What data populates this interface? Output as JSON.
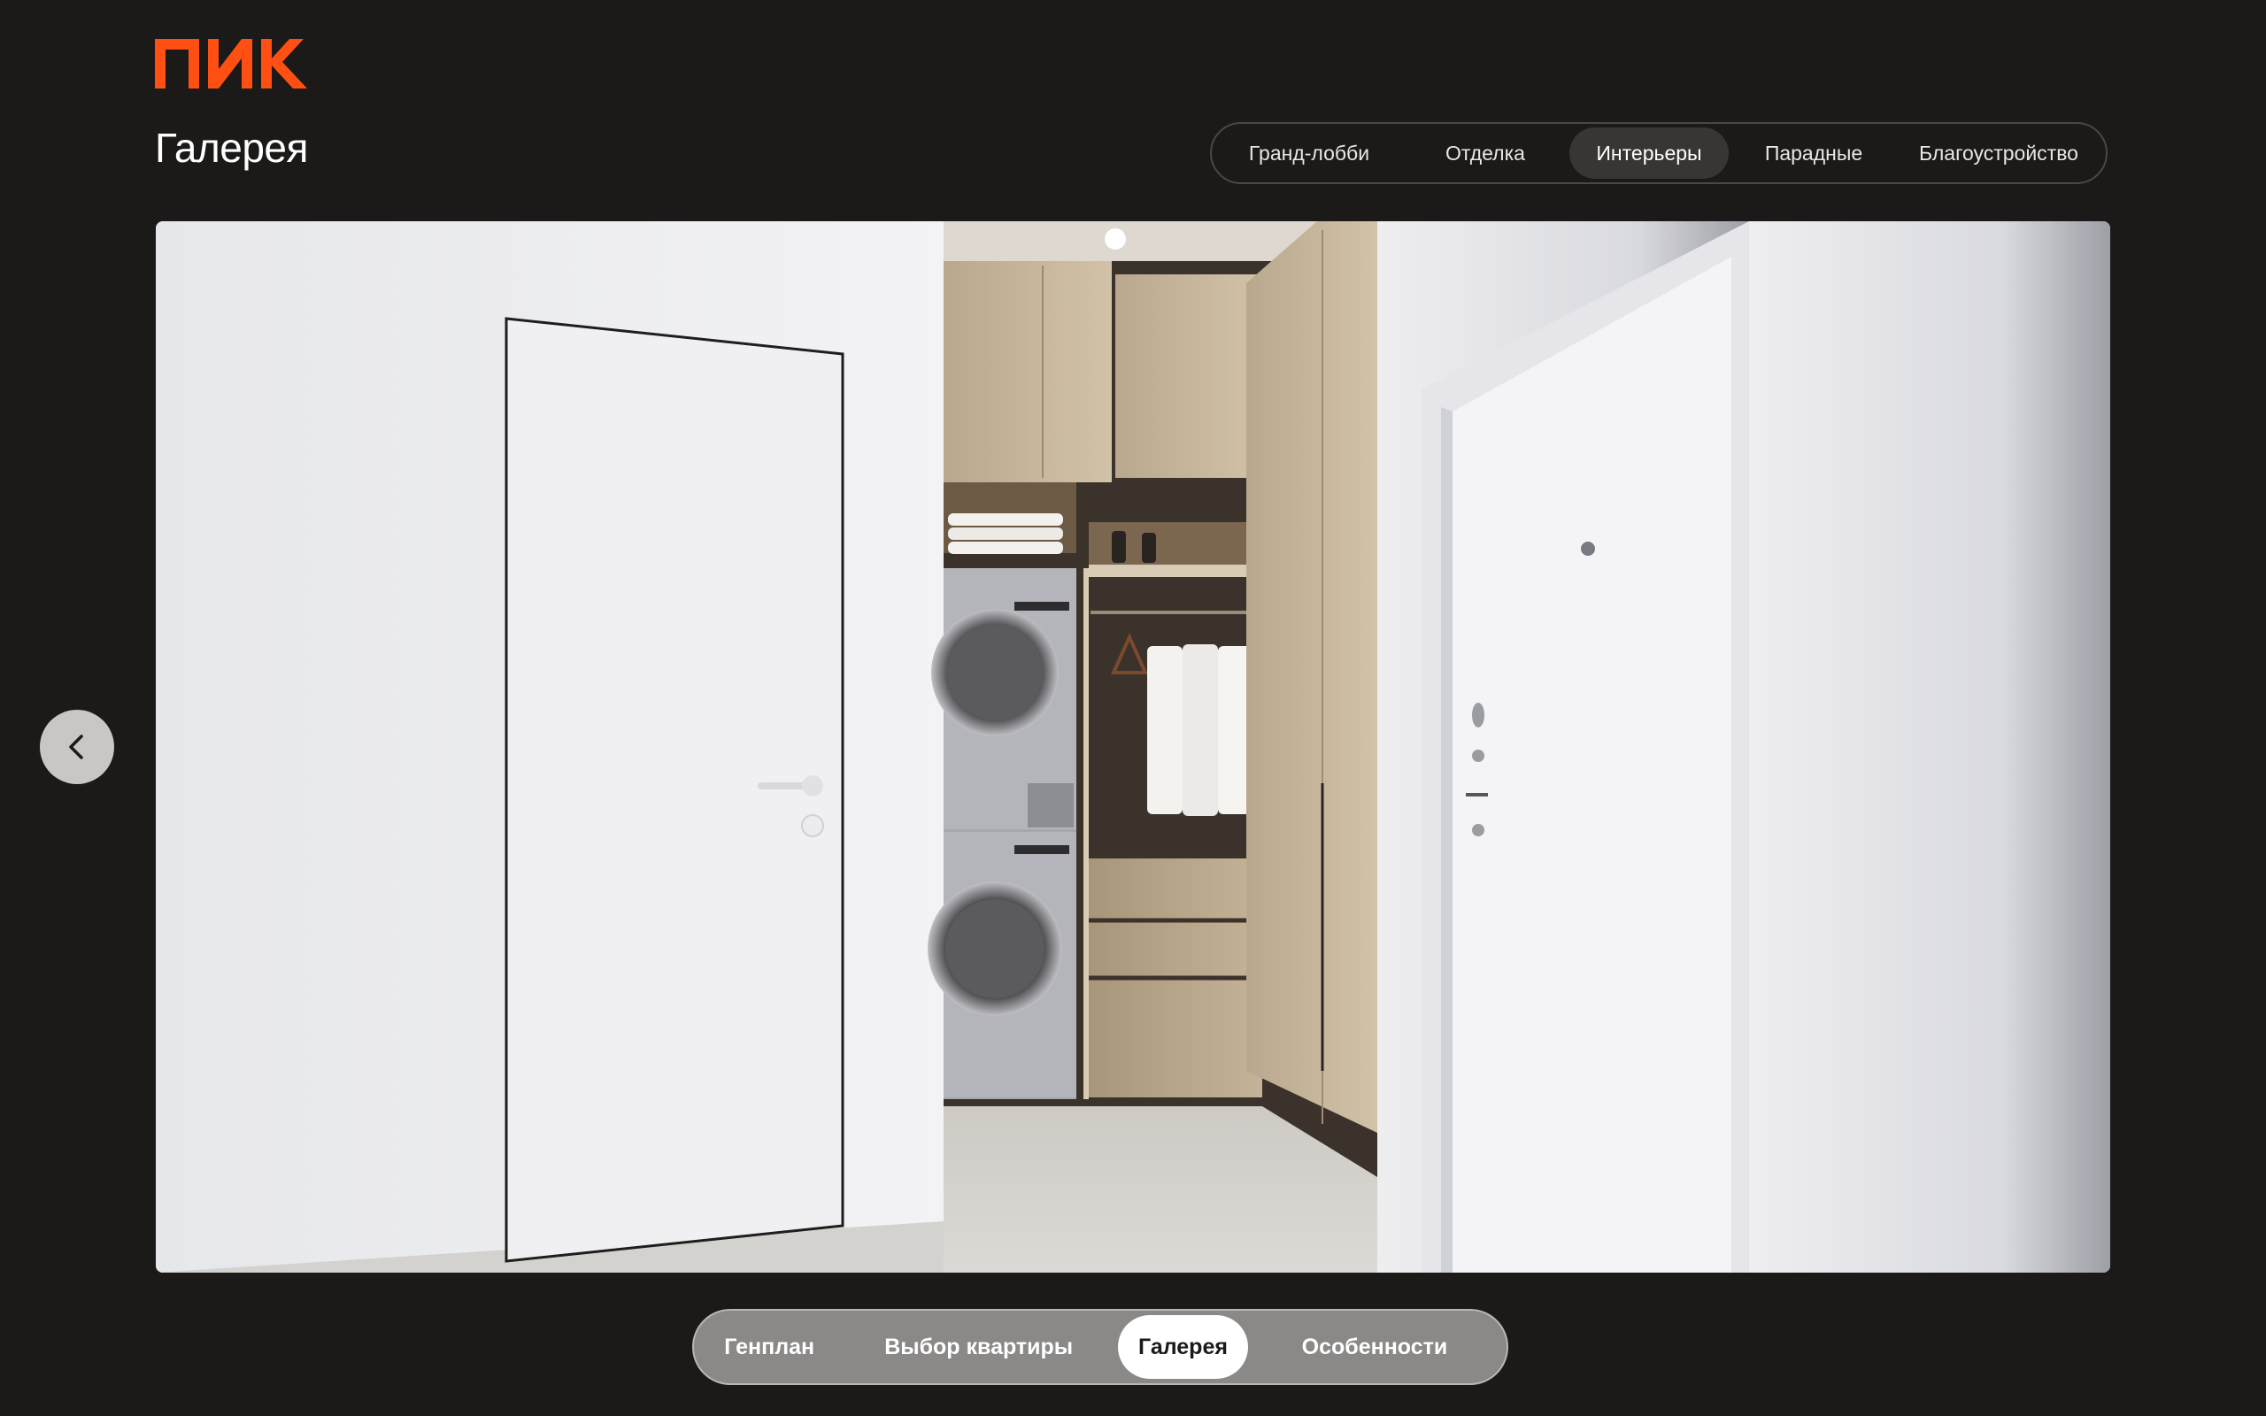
{
  "brand": {
    "name": "ПИК",
    "color": "#ff4f12"
  },
  "header": {
    "title": "Галерея"
  },
  "category_tabs": [
    {
      "label": "Гранд-лобби",
      "active": false
    },
    {
      "label": "Отделка",
      "active": false
    },
    {
      "label": "Интерьеры",
      "active": true
    },
    {
      "label": "Парадные",
      "active": false
    },
    {
      "label": "Благоустройство",
      "active": false
    }
  ],
  "gallery": {
    "prev_icon": "chevron-left-icon"
  },
  "bottom_nav": [
    {
      "label": "Генплан",
      "active": false
    },
    {
      "label": "Выбор квартиры",
      "active": false
    },
    {
      "label": "Галерея",
      "active": true
    },
    {
      "label": "Особенности",
      "active": false
    }
  ],
  "colors": {
    "background": "#1c1a19",
    "accent": "#ff4f12",
    "tab_active": "#383634"
  }
}
